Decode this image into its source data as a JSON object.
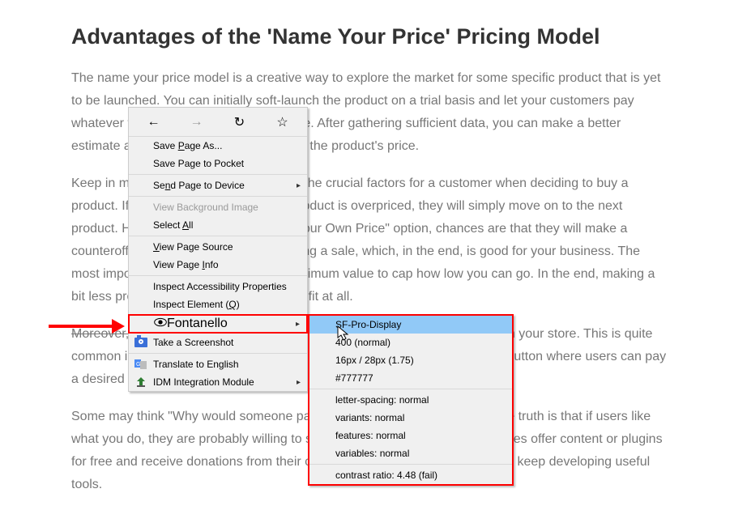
{
  "article": {
    "heading": "Advantages of the 'Name Your Price' Pricing Model",
    "p1": "The name your price model is a creative way to explore the market for some specific product that is yet to be launched. You can initially soft-launch the product on a trial basis and let your customers pay whatever they want for it for a limited time. After gathering sufficient data, you can make a better estimate and decide if the cost should be the product's price.",
    "p2": "Keep in mind that price is usually one of the crucial factors for a customer when deciding to buy a product. If the customer believes your product is overpriced, they will simply move on to the next product. However, by using the \"Name Your Own Price\" option, chances are that they will make a counteroffer, and you might end up making a sale, which, in the end, is good for your business. The most important thing is that you set a minimum value to cap how low you can go. In the end, making a bit less profit is better than making no profit at all.",
    "p3a": "Moreover,",
    "p3b": " you can use this plugin to accept donations or run fundraisers from your store. This is quite common in the music industry. Moreover, many websites have a \"Donation\" button where users can pay a desired amount.",
    "p4": "Some may think \"Why would someone pay for something that's free?\" but the truth is that if users like what you do, they are probably willing to support you. This is why so many sites offer content or plugins for free and receive donations from their community to compensate them and keep developing useful tools."
  },
  "contextMenu": {
    "savePageAs": "Save Page As...",
    "savePocket": "Save Page to Pocket",
    "sendDevice": "Send Page to Device",
    "viewBg": "View Background Image",
    "selectAll": "Select All",
    "viewSource": "View Page Source",
    "viewInfo": "View Page Info",
    "inspectA11y": "Inspect Accessibility Properties",
    "inspectElement": "Inspect Element (Q)",
    "fontanello": "Fontanello",
    "screenshot": "Take a Screenshot",
    "translate": "Translate to English",
    "idm": "IDM Integration Module"
  },
  "fontPanel": {
    "family": "SF-Pro-Display",
    "weight": "400 (normal)",
    "size": "16px / 28px (1.75)",
    "color": "#777777",
    "letterSpacing": "letter-spacing: normal",
    "variants": "variants: normal",
    "features": "features: normal",
    "variables": "variables: normal",
    "contrast": "contrast ratio: 4.48 (fail)"
  }
}
